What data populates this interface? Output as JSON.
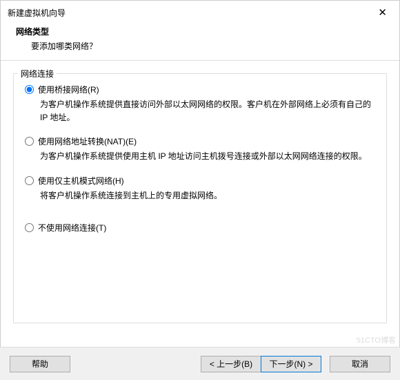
{
  "window": {
    "title": "新建虚拟机向导",
    "close_glyph": "✕"
  },
  "header": {
    "heading": "网络类型",
    "sub": "要添加哪类网络？"
  },
  "group": {
    "legend": "网络连接"
  },
  "options": {
    "bridged": {
      "label": "使用桥接网络(R)",
      "desc": "为客户机操作系统提供直接访问外部以太网网络的权限。客户机在外部网络上必须有自己的 IP 地址。"
    },
    "nat": {
      "label": "使用网络地址转换(NAT)(E)",
      "desc": "为客户机操作系统提供使用主机 IP 地址访问主机拨号连接或外部以太网网络连接的权限。"
    },
    "hostonly": {
      "label": "使用仅主机模式网络(H)",
      "desc": "将客户机操作系统连接到主机上的专用虚拟网络。"
    },
    "none": {
      "label": "不使用网络连接(T)"
    }
  },
  "footer": {
    "help": "帮助",
    "back": "< 上一步(B)",
    "next": "下一步(N) >",
    "cancel": "取消"
  },
  "watermark": "51CTO博客"
}
